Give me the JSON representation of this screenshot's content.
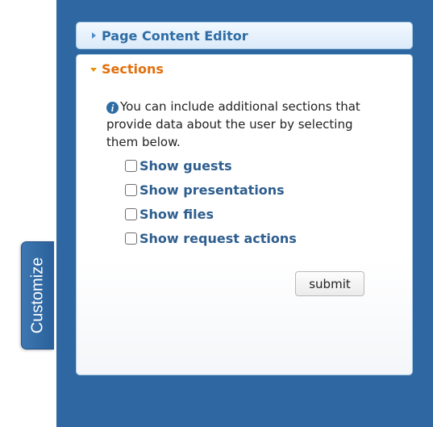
{
  "customize_tab": {
    "label": "Customize"
  },
  "accordion": {
    "page_content_editor": {
      "title": "Page Content Editor",
      "expanded": false
    },
    "sections": {
      "title": "Sections",
      "expanded": true,
      "info_icon": "info-icon",
      "info_text": "You can include additional sections that provide data about the user by selecting them below.",
      "options": [
        {
          "label": "Show guests",
          "checked": false
        },
        {
          "label": "Show presentations",
          "checked": false
        },
        {
          "label": "Show files",
          "checked": false
        },
        {
          "label": "Show request actions",
          "checked": false
        }
      ],
      "submit_label": "submit"
    }
  },
  "colors": {
    "panel_background": "#2e67a2",
    "header_text": "#2e6da4",
    "active_header_text": "#e26f0c",
    "option_text": "#2e5e8f"
  }
}
